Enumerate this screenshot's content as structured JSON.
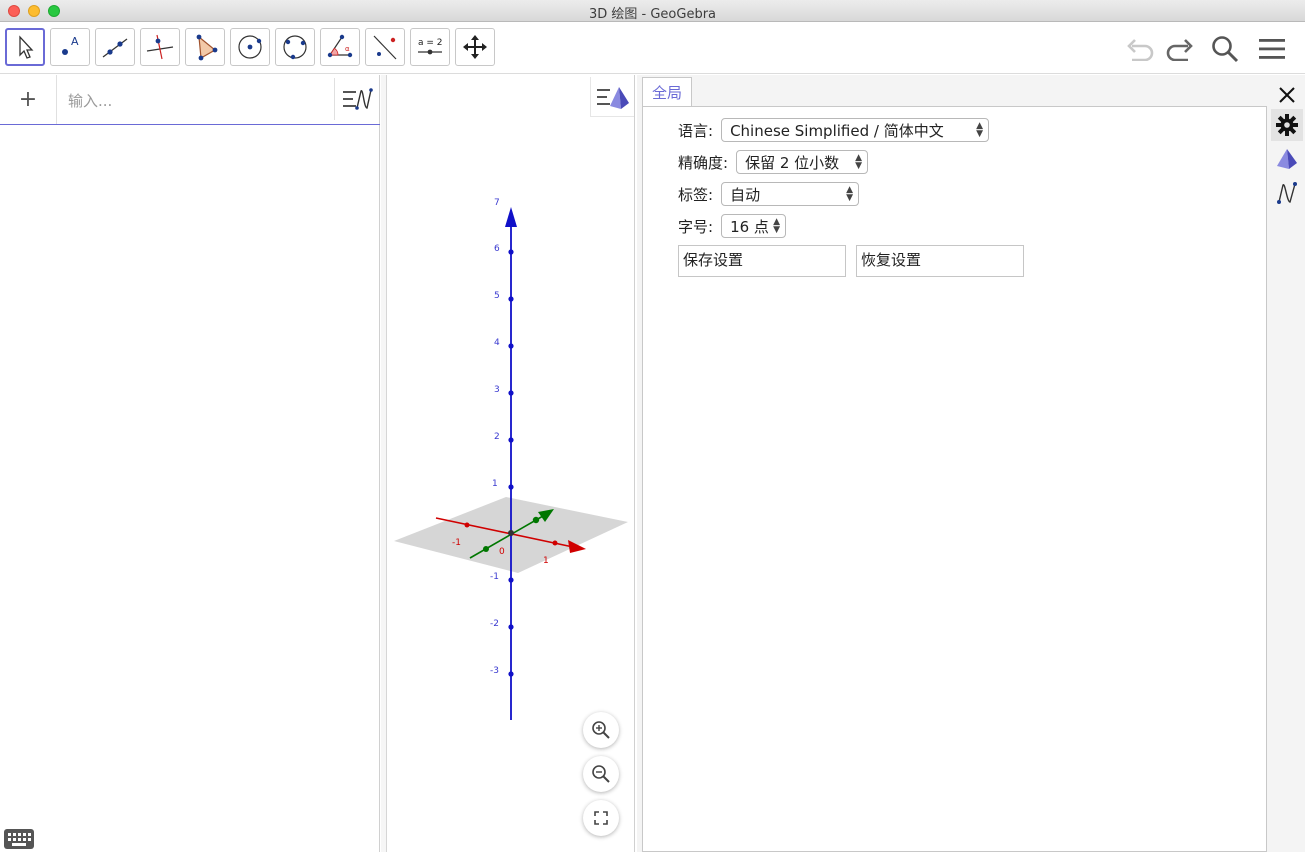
{
  "window": {
    "title": "3D 绘图 - GeoGebra"
  },
  "toolbar": {
    "tools": [
      {
        "name": "move"
      },
      {
        "name": "point"
      },
      {
        "name": "line"
      },
      {
        "name": "perpendicular"
      },
      {
        "name": "polygon"
      },
      {
        "name": "circle"
      },
      {
        "name": "circle-through-points"
      },
      {
        "name": "angle"
      },
      {
        "name": "reflect"
      },
      {
        "name": "slider",
        "label": "a = 2"
      },
      {
        "name": "move-graphics"
      }
    ],
    "slider_label": "a = 2"
  },
  "algebra": {
    "add_label": "+",
    "input_placeholder": "输入..."
  },
  "view3d": {
    "z_ticks": [
      "7",
      "6",
      "5",
      "4",
      "3",
      "2",
      "1",
      "-1",
      "-2",
      "-3"
    ],
    "x_ticks": [
      "-1",
      "1"
    ],
    "origin_label": "0",
    "colors": {
      "x_axis": "#d00000",
      "y_axis": "#007700",
      "z_axis": "#1010c8",
      "plane": "#c8c8c8"
    }
  },
  "settings": {
    "tab": "全局",
    "language": {
      "label": "语言:",
      "value": "Chinese Simplified / 简体中文"
    },
    "rounding": {
      "label": "精确度:",
      "value": "保留 2 位小数"
    },
    "labeling": {
      "label": "标签:",
      "value": "自动"
    },
    "font_size": {
      "label": "字号:",
      "value": "16 点"
    },
    "save_button": "保存设置",
    "restore_button": "恢复设置"
  },
  "accent_color": "#6a6ad6"
}
